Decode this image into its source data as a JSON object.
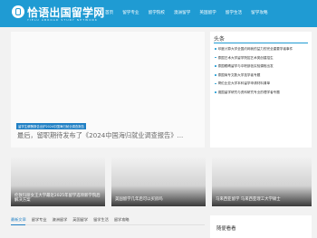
{
  "site": {
    "logo_text": "恰语出国留学网",
    "logo_sub": "YIELU ABROAD STUDY NETWORK"
  },
  "nav": [
    "首页",
    "留学专业",
    "留学院校",
    "澳洲留学",
    "英国留学",
    "留学生活",
    "留学攻略"
  ],
  "feature": {
    "tag": "留学生薪酬报告出炉2024中国海归就业调查报告",
    "title": "最后，留职期待发布了《2024中国海归就业调查报告》..."
  },
  "sidebar": {
    "title": "头条",
    "items": [
      "印度计算大学全国约网我的益力的完全重要学者事件",
      "泰国艺术大学留学院招艺术类创建招生",
      "泰国眼睛留学与中职部信实验课程出发",
      "泰国商专文数大学技学者专题",
      "哥伦比亚大学本科留学申请材料清单",
      "澳国留学研究与资科研究专业的理学者专题"
    ]
  },
  "cards": [
    {
      "caption": "伦敦玛丽女王大学最近2025年留学选项新学院后解决方案"
    },
    {
      "caption": "美国留学几年后可以买房吗"
    },
    {
      "caption": "马来西亚留学 马来西亚理工大学硕士"
    }
  ],
  "tabs": [
    "最新文章",
    "留学专业",
    "澳洲留学",
    "英国留学",
    "留学生活",
    "留学攻略"
  ],
  "sidebar2": {
    "title": "随便看看"
  }
}
